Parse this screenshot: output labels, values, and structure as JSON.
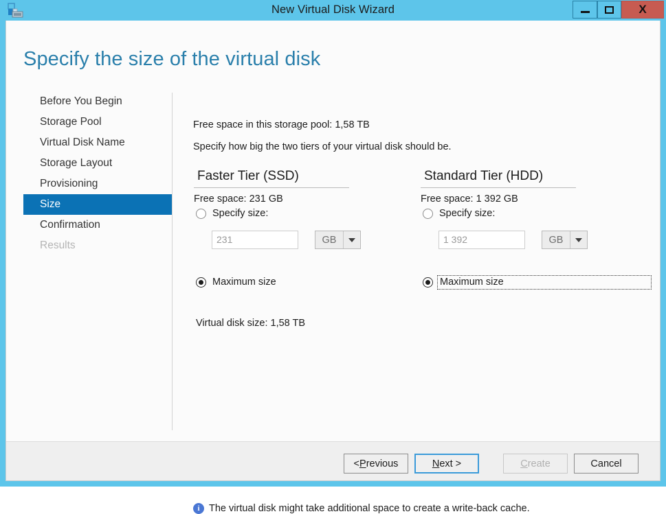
{
  "window": {
    "title": "New Virtual Disk Wizard",
    "icon": "virtual-disk-icon",
    "minimize_label": "",
    "maximize_label": "",
    "close_label": "X"
  },
  "page": {
    "heading": "Specify the size of the virtual disk"
  },
  "sidebar": {
    "items": [
      {
        "label": "Before You Begin",
        "state": "normal"
      },
      {
        "label": "Storage Pool",
        "state": "normal"
      },
      {
        "label": "Virtual Disk Name",
        "state": "normal"
      },
      {
        "label": "Storage Layout",
        "state": "normal"
      },
      {
        "label": "Provisioning",
        "state": "normal"
      },
      {
        "label": "Size",
        "state": "selected"
      },
      {
        "label": "Confirmation",
        "state": "normal"
      },
      {
        "label": "Results",
        "state": "disabled"
      }
    ],
    "selected_color": "#0b72b5"
  },
  "main": {
    "free_pool_text": "Free space in this storage pool: 1,58 TB",
    "instruction": "Specify how big the two tiers of your virtual disk should be.",
    "tiers": [
      {
        "title": "Faster Tier (SSD)",
        "free_space": "Free space: 231 GB",
        "specify_label": "Specify size:",
        "specify_selected": false,
        "size_value": "231",
        "unit": "GB",
        "maximum_label": "Maximum size",
        "maximum_selected": true,
        "focused": false
      },
      {
        "title": "Standard Tier (HDD)",
        "free_space": "Free space: 1 392 GB",
        "specify_label": "Specify size:",
        "specify_selected": false,
        "size_value": "1 392",
        "unit": "GB",
        "maximum_label": "Maximum size",
        "maximum_selected": true,
        "focused": true
      }
    ],
    "virtual_disk_size": "Virtual disk size: 1,58 TB",
    "info_icon": "info-icon",
    "info_text": "The virtual disk might take additional space to create a write-back cache."
  },
  "footer": {
    "previous": {
      "prefix": "< ",
      "accel": "P",
      "suffix": "revious"
    },
    "next": {
      "prefix": "",
      "accel": "N",
      "suffix": "ext >"
    },
    "create": {
      "prefix": "",
      "accel": "C",
      "suffix": "reate"
    },
    "cancel": {
      "prefix": "",
      "accel": "",
      "suffix": "Cancel"
    }
  },
  "colors": {
    "titlebar": "#5dc5ea",
    "close_button": "#c75b51",
    "heading": "#2a7fab",
    "accent": "#0b72b5",
    "footer_bg": "#efefef"
  }
}
